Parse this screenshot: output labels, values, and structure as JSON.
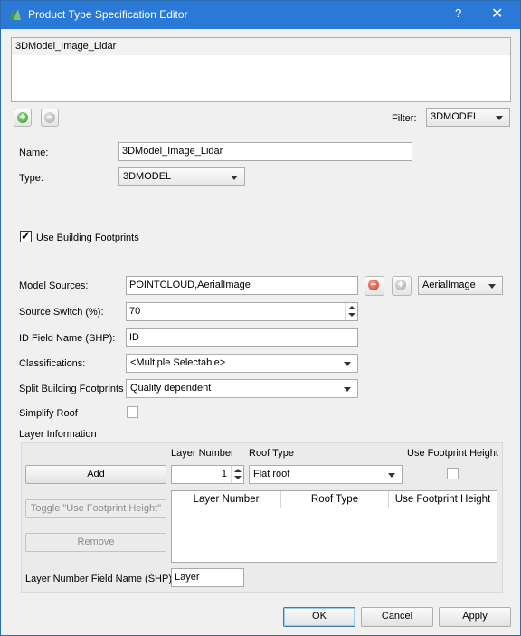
{
  "window": {
    "title": "Product Type Specification Editor",
    "help_label": "?",
    "close_label": "✕"
  },
  "list": {
    "items": [
      "3DModel_Image_Lidar"
    ]
  },
  "toolbar": {
    "add_symbol": "+",
    "remove_symbol": "−",
    "filter_label": "Filter:",
    "filter_value": "3DMODEL"
  },
  "form": {
    "name_label": "Name:",
    "name_value": "3DModel_Image_Lidar",
    "type_label": "Type:",
    "type_value": "3DMODEL",
    "use_footprints_label": "Use Building Footprints",
    "use_footprints_checked": true,
    "model_sources_label": "Model Sources:",
    "model_sources_value": "POINTCLOUD,AerialImage",
    "model_source_select": "AerialImage",
    "source_switch_label": "Source Switch (%):",
    "source_switch_value": "70",
    "id_field_label": "ID Field Name (SHP):",
    "id_field_value": "ID",
    "classifications_label": "Classifications:",
    "classifications_value": "<Multiple Selectable>",
    "split_label": "Split Building Footprints",
    "split_value": "Quality dependent",
    "simplify_label": "Simplify Roof",
    "simplify_checked": false,
    "layer_info_label": "Layer Information"
  },
  "layer": {
    "layer_number_label": "Layer Number",
    "roof_type_label": "Roof Type",
    "use_height_label": "Use Footprint Height",
    "add_label": "Add",
    "layer_number_value": "1",
    "roof_type_value": "Flat roof",
    "toggle_label": "Toggle \"Use Footprint Height\"",
    "remove_label": "Remove",
    "columns": [
      "Layer Number",
      "Roof Type",
      "Use Footprint Height"
    ],
    "field_label": "Layer Number Field Name (SHP):",
    "field_value": "Layer"
  },
  "footer": {
    "ok_label": "OK",
    "cancel_label": "Cancel",
    "apply_label": "Apply"
  },
  "colors": {
    "titlebar": "#2b79d6",
    "accent_green": "#2f9a1b",
    "accent_red": "#d2311f"
  }
}
